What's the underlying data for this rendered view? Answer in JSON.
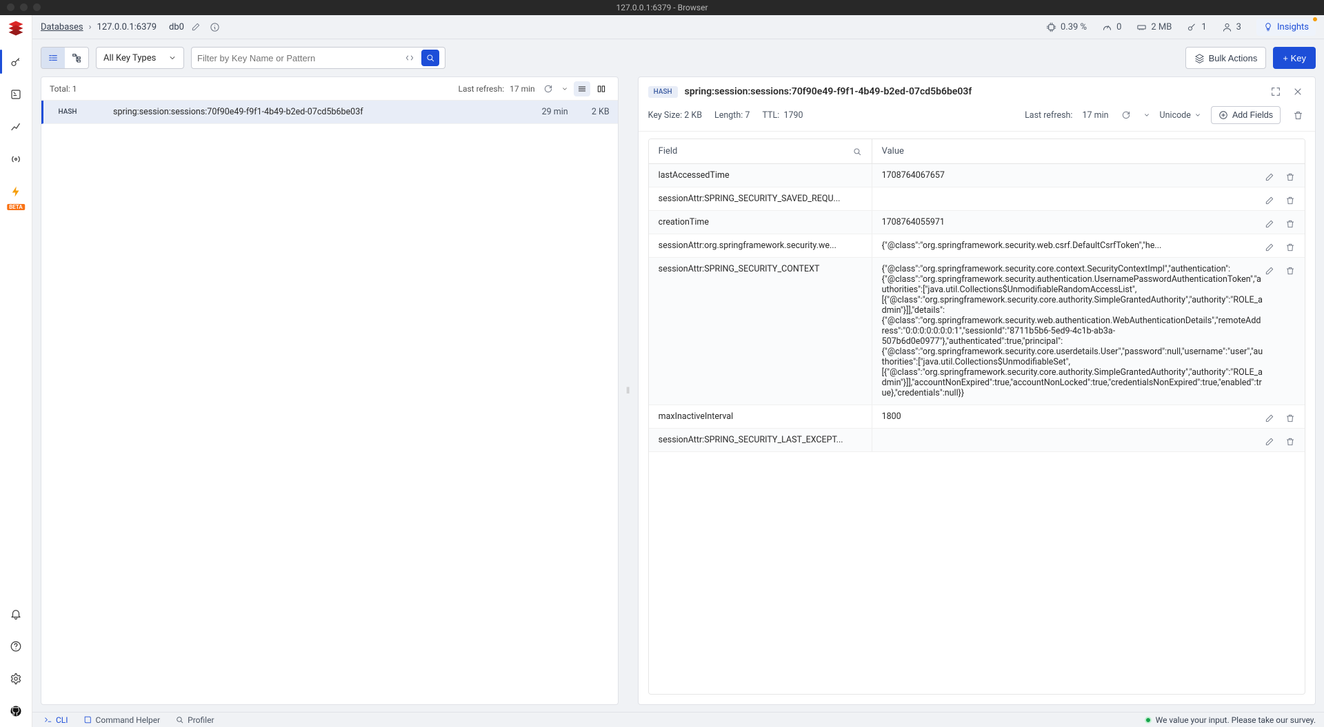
{
  "window_title": "127.0.0.1:6379 - Browser",
  "breadcrumb": {
    "root": "Databases",
    "endpoint": "127.0.0.1:6379"
  },
  "db": "db0",
  "stats": {
    "cpu": "0.39 %",
    "net": "0",
    "memory": "2 MB",
    "keys": "1",
    "clients": "3"
  },
  "insights_label": "Insights",
  "toolbar": {
    "keytype": "All Key Types",
    "filter_placeholder": "Filter by Key Name or Pattern",
    "bulk": "Bulk Actions",
    "addkey": "+ Key"
  },
  "left": {
    "total_label": "Total:",
    "total": "1",
    "last_refresh_label": "Last refresh:",
    "last_refresh": "17 min",
    "rows": [
      {
        "type": "HASH",
        "name": "spring:session:sessions:70f90e49-f9f1-4b49-b2ed-07cd5b6be03f",
        "ttl": "29 min",
        "size": "2 KB"
      }
    ]
  },
  "right": {
    "type": "HASH",
    "name": "spring:session:sessions:70f90e49-f9f1-4b49-b2ed-07cd5b6be03f",
    "keysize_label": "Key Size:",
    "keysize": "2 KB",
    "length_label": "Length:",
    "length": "7",
    "ttl_label": "TTL:",
    "ttl": "1790",
    "last_refresh_label": "Last refresh:",
    "last_refresh": "17 min",
    "encoding": "Unicode",
    "addfields": "Add Fields",
    "headers": {
      "field": "Field",
      "value": "Value"
    },
    "rows": [
      {
        "field": "lastAccessedTime",
        "value": "1708764067657"
      },
      {
        "field": "sessionAttr:SPRING_SECURITY_SAVED_REQU...",
        "value": ""
      },
      {
        "field": "creationTime",
        "value": "1708764055971"
      },
      {
        "field": "sessionAttr:org.springframework.security.we...",
        "value": "{\"@class\":\"org.springframework.security.web.csrf.DefaultCsrfToken\",\"he..."
      },
      {
        "field": "sessionAttr:SPRING_SECURITY_CONTEXT",
        "value": "{\"@class\":\"org.springframework.security.core.context.SecurityContextImpl\",\"authentication\":{\"@class\":\"org.springframework.security.authentication.UsernamePasswordAuthenticationToken\",\"authorities\":[\"java.util.Collections$UnmodifiableRandomAccessList\",[{\"@class\":\"org.springframework.security.core.authority.SimpleGrantedAuthority\",\"authority\":\"ROLE_admin\"}]],\"details\":{\"@class\":\"org.springframework.security.web.authentication.WebAuthenticationDetails\",\"remoteAddress\":\"0:0:0:0:0:0:0:1\",\"sessionId\":\"8711b5b6-5ed9-4c1b-ab3a-507b6d0e0977\"},\"authenticated\":true,\"principal\":{\"@class\":\"org.springframework.security.core.userdetails.User\",\"password\":null,\"username\":\"user\",\"authorities\":[\"java.util.Collections$UnmodifiableSet\",[{\"@class\":\"org.springframework.security.core.authority.SimpleGrantedAuthority\",\"authority\":\"ROLE_admin\"}]],\"accountNonExpired\":true,\"accountNonLocked\":true,\"credentialsNonExpired\":true,\"enabled\":true},\"credentials\":null}}"
      },
      {
        "field": "maxInactiveInterval",
        "value": "1800"
      },
      {
        "field": "sessionAttr:SPRING_SECURITY_LAST_EXCEPT...",
        "value": ""
      }
    ]
  },
  "footer": {
    "cli": "CLI",
    "helper": "Command Helper",
    "profiler": "Profiler",
    "survey": "We value your input. Please take our survey."
  }
}
